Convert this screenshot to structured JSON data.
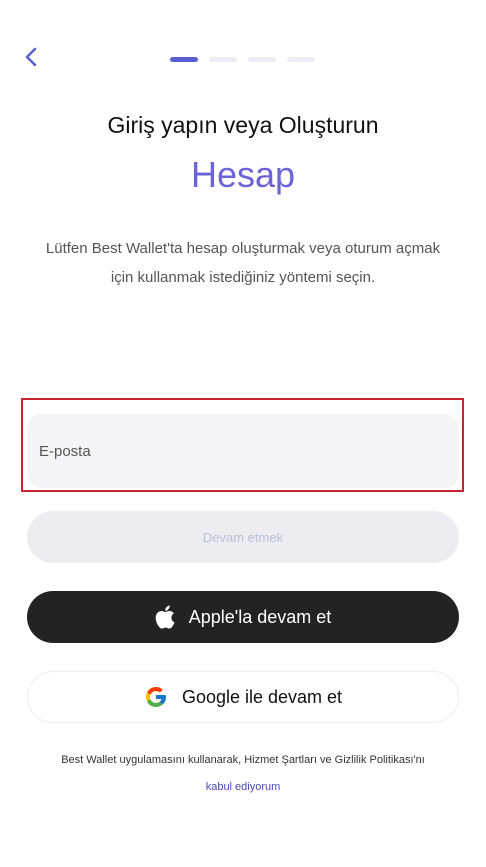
{
  "header": {
    "back_icon": "chevron-left-icon",
    "progress_steps": 4,
    "progress_active_index": 0,
    "accent_color": "#5b5fd6"
  },
  "heading": {
    "title": "Giriş yapın veya Oluşturun",
    "accent": "Hesap",
    "subtitle": "Lütfen Best Wallet'ta hesap oluşturmak veya oturum açmak için kullanmak istediğiniz yöntemi seçin."
  },
  "form": {
    "email_placeholder": "E-posta",
    "email_value": "",
    "highlight_color": "#c8242f"
  },
  "buttons": {
    "continue_label": "Devam etmek",
    "apple_label": "Apple'la devam et",
    "apple_icon": "apple-icon",
    "google_label": "Google ile devam et",
    "google_icon": "google-icon"
  },
  "terms": {
    "text": "Best Wallet uygulamasını kullanarak, Hizmet Şartları ve Gizlilik Politikası'nı",
    "link": "kabul ediyorum"
  }
}
